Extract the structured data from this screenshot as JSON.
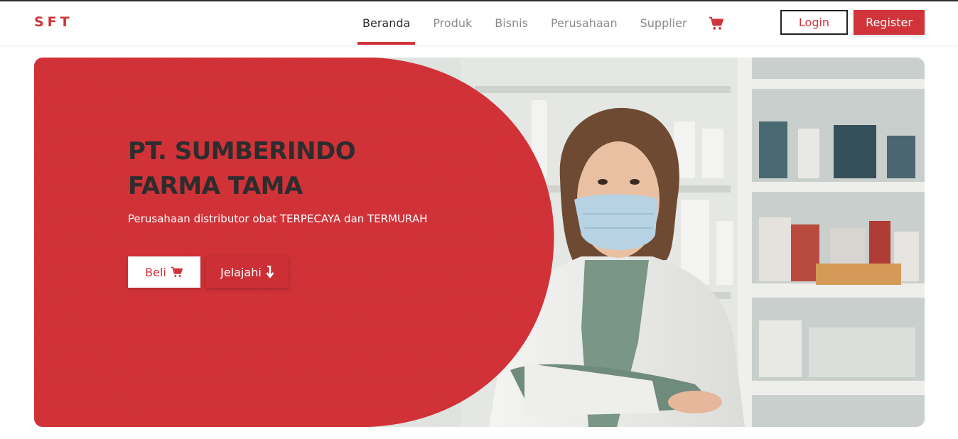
{
  "brand": {
    "logo": "SFT",
    "accent": "#d0343a"
  },
  "nav": {
    "items": [
      {
        "label": "Beranda",
        "active": true
      },
      {
        "label": "Produk",
        "active": false
      },
      {
        "label": "Bisnis",
        "active": false
      },
      {
        "label": "Perusahaan",
        "active": false
      },
      {
        "label": "Supplier",
        "active": false
      }
    ],
    "cart_icon": "shopping-cart-icon"
  },
  "auth": {
    "login_label": "Login",
    "register_label": "Register"
  },
  "hero": {
    "title_line1": "PT. SUMBERINDO",
    "title_line2": "FARMA TAMA",
    "subtitle": "Perusahaan distributor obat TERPECAYA dan TERMURAH",
    "buy_label": "Beli",
    "buy_icon": "shopping-cart-icon",
    "explore_label": "Jelajahi",
    "explore_icon": "arrow-down-icon",
    "image": "pharmacist-woman-mask-photo"
  }
}
